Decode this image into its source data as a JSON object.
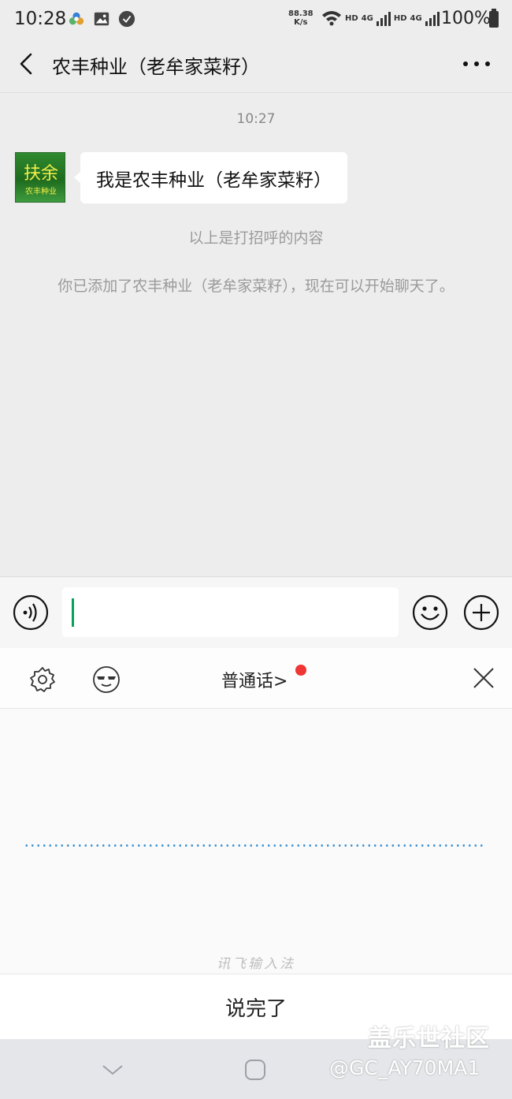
{
  "status_bar": {
    "time": "10:28",
    "speed_value": "88.38",
    "speed_unit": "K/s",
    "hd1": "HD",
    "net1": "4G",
    "hd2": "HD",
    "net2": "4G",
    "battery": "100%",
    "left_icons": [
      "cloud-icon",
      "image-icon",
      "check-badge-icon"
    ]
  },
  "header": {
    "title": "农丰种业（老牟家菜籽）"
  },
  "chat": {
    "timestamp": "10:27",
    "avatar": {
      "line1": "扶余",
      "line2": "农丰种业",
      "bg": "#1e6b1e",
      "text_color": "#f2ef4a"
    },
    "message": "我是农丰种业（老牟家菜籽）",
    "system_greeting": "以上是打招呼的内容",
    "system_added": "你已添加了农丰种业（老牟家菜籽），现在可以开始聊天了。"
  },
  "input_bar": {
    "value": "",
    "caret_color": "#07a05a"
  },
  "ime": {
    "language": "普通话>",
    "brand": "讯飞输入法",
    "done_label": "说完了",
    "line_color": "#3f93d3"
  },
  "watermark": {
    "line1": "盖乐世社区",
    "line2": "@GC_AY70MA1"
  }
}
